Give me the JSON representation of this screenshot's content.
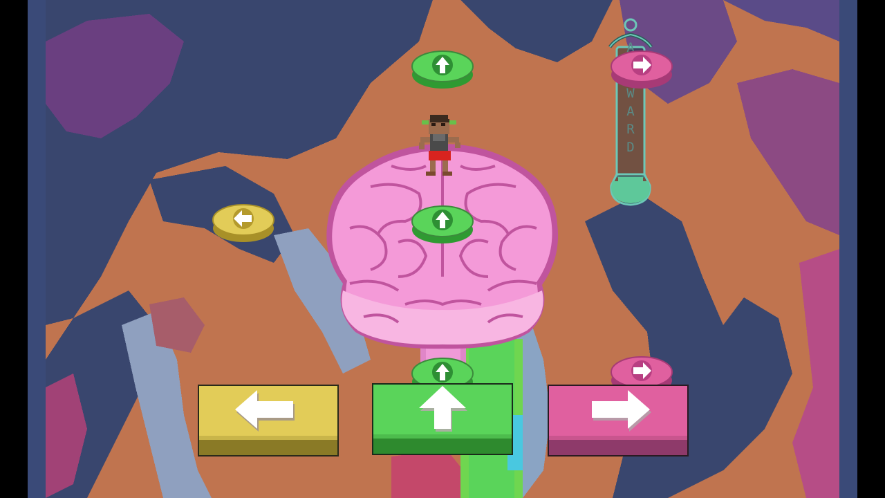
{
  "game": {
    "meter": {
      "label_letters": [
        "A",
        "R",
        "W",
        "A",
        "R",
        "D"
      ],
      "label": "ARWARD",
      "fill_fraction": 0.2
    },
    "controls": {
      "left_button_icon": "arrow-left-icon",
      "up_button_icon": "arrow-up-icon",
      "right_button_icon": "arrow-right-icon"
    },
    "notes": [
      {
        "lane": "up",
        "icon": "arrow-up-icon",
        "color": "#5ad45a"
      },
      {
        "lane": "right",
        "icon": "arrow-right-icon",
        "color": "#e0609f"
      },
      {
        "lane": "left",
        "icon": "arrow-left-icon",
        "color": "#e2cc58"
      },
      {
        "lane": "up",
        "icon": "arrow-up-icon",
        "color": "#5ad45a"
      },
      {
        "lane": "up",
        "icon": "arrow-up-icon",
        "color": "#5ad45a"
      },
      {
        "lane": "right",
        "icon": "arrow-right-icon",
        "color": "#e0609f"
      }
    ],
    "colors": {
      "left": "#e2cc58",
      "up": "#5ad45a",
      "right": "#e0609f",
      "brain": "#f29ad6",
      "frame": "#3a4a78"
    }
  }
}
